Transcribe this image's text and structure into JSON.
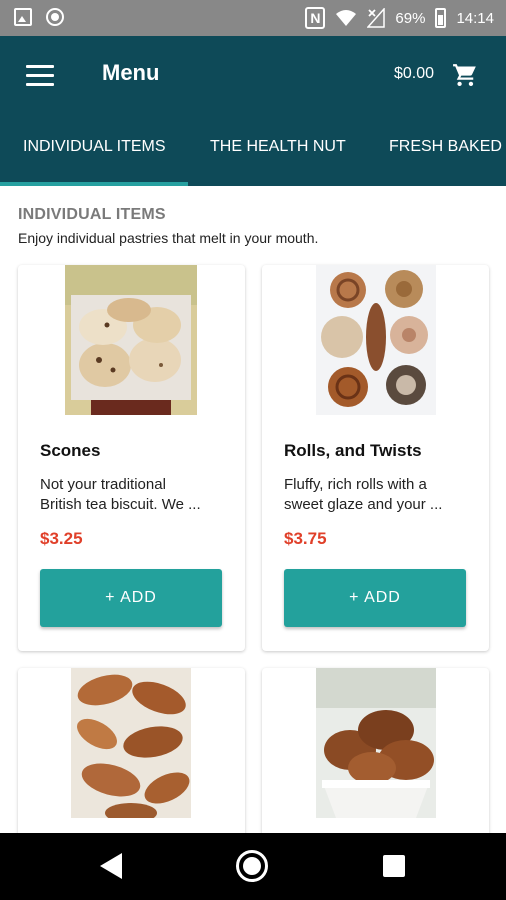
{
  "status_bar": {
    "battery": "69%",
    "time": "14:14",
    "icons": [
      "image-icon",
      "circle-icon",
      "nfc-icon",
      "wifi-icon",
      "signal-icon",
      "battery-icon"
    ]
  },
  "app_bar": {
    "title": "Menu",
    "cart_total": "$0.00",
    "color": "#0e4a58"
  },
  "tabs": [
    {
      "label": "INDIVIDUAL ITEMS",
      "selected": true
    },
    {
      "label": "THE HEALTH NUT",
      "selected": false
    },
    {
      "label": "FRESH BAKED B",
      "selected": false
    }
  ],
  "section": {
    "heading": "INDIVIDUAL ITEMS",
    "subtitle": "Enjoy individual pastries that melt in your mouth."
  },
  "products": [
    {
      "name": "Scones",
      "desc_line1": "Not your traditional",
      "desc_line2": "British tea biscuit. We ...",
      "price": "$3.25",
      "button": "+ ADD"
    },
    {
      "name": "Rolls, and Twists",
      "desc_line1": "Fluffy, rich rolls with a",
      "desc_line2": "sweet glaze and your ...",
      "price": "$3.75",
      "button": "+ ADD"
    }
  ],
  "colors": {
    "accent": "#23a19c",
    "price": "#e0402a",
    "tab_indicator": "#26a0a0"
  }
}
